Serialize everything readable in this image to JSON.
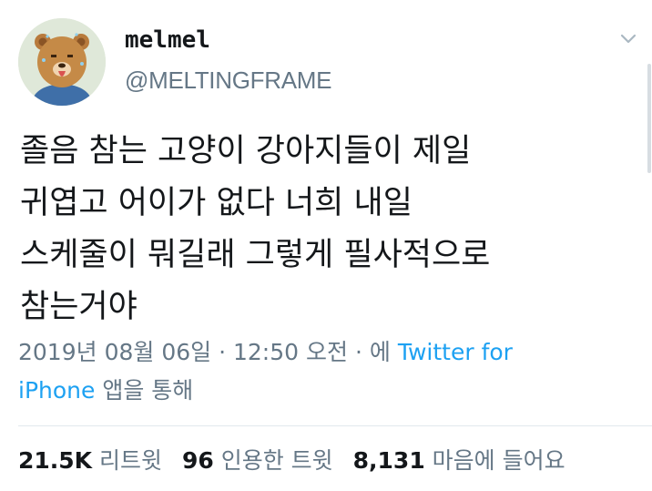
{
  "user": {
    "display_name": "melmel",
    "handle": "@MELTINGFRAME",
    "avatar_icon": "bear-avatar-icon",
    "more_icon": "chevron-down-icon"
  },
  "tweet": {
    "lines": [
      "졸음 참는 고양이 강아지들이 제일",
      "귀엽고 어이가 없다 너희 내일",
      "스케줄이 뭐길래 그렇게 필사적으로",
      "참는거야"
    ],
    "date": "2019년 08월 06일",
    "sep1": "·",
    "time": "12:50 오전",
    "sep2": "·",
    "via": "에",
    "source_link": "Twitter for iPhone",
    "source_suffix": "앱을 통해"
  },
  "stats": {
    "retweets_count": "21.5K",
    "retweets_label": "리트윗",
    "quotes_count": "96",
    "quotes_label": "인용한 트윗",
    "likes_count": "8,131",
    "likes_label": "마음에 들어요"
  },
  "colors": {
    "text": "#14171a",
    "secondary": "#657786",
    "link": "#1da1f2",
    "divider": "#e1e8ed"
  }
}
